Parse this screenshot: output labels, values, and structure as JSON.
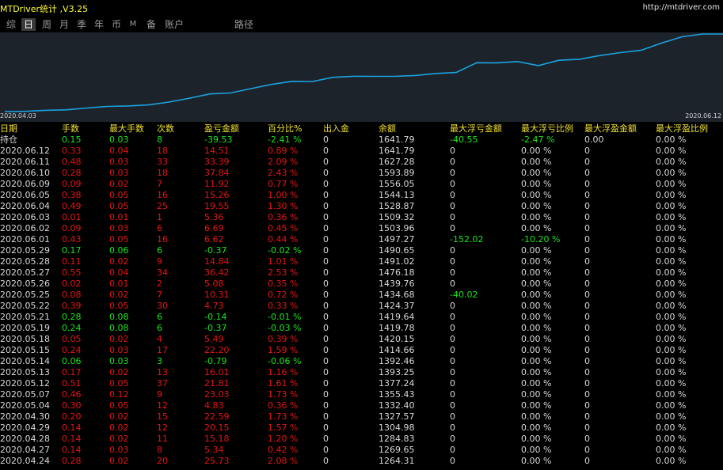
{
  "window": {
    "title": "MTDriver统计 ,V3.25",
    "url": "http://mtdriver.com"
  },
  "tabs": [
    {
      "label": "综",
      "active": false
    },
    {
      "label": "日",
      "active": true
    },
    {
      "label": "周",
      "active": false
    },
    {
      "label": "月",
      "active": false
    },
    {
      "label": "季",
      "active": false
    },
    {
      "label": "年",
      "active": false
    },
    {
      "label": "币",
      "active": false
    },
    {
      "label": "M",
      "active": false
    },
    {
      "label": "备",
      "active": false
    },
    {
      "label": "账户",
      "active": false
    },
    {
      "label": "路径",
      "active": false
    }
  ],
  "equity_chart": {
    "start_label": "2020.04.03",
    "end_label": "2020.06.12",
    "line_color": "#1aa3e0",
    "values": [
      1234.8,
      1236.2,
      1241.5,
      1244.1,
      1253.3,
      1261.8,
      1264.31,
      1269.65,
      1284.83,
      1304.98,
      1327.57,
      1332.4,
      1355.43,
      1377.24,
      1393.25,
      1392.46,
      1414.66,
      1420.15,
      1419.78,
      1419.64,
      1424.37,
      1434.68,
      1439.76,
      1491.02,
      1490.65,
      1497.27,
      1476.18,
      1503.96,
      1509.32,
      1528.87,
      1544.13,
      1556.05,
      1593.89,
      1627.28,
      1641.79,
      1641.79
    ]
  },
  "table": {
    "headers": [
      "日期",
      "手数",
      "最大手数",
      "次数",
      "盈亏金额",
      "百分比%",
      "出入金",
      "余额",
      "最大浮亏金额",
      "最大浮亏比例",
      "最大浮盈金额",
      "最大浮盈比例"
    ],
    "rows": [
      [
        "持仓",
        "0.15",
        "0.03",
        "8",
        "-39.53",
        "-2.41 %",
        "0",
        "1641.79",
        "-40.55",
        "-2.47 %",
        "0.00",
        "0.00 %"
      ],
      [
        "2020.06.12",
        "0.33",
        "0.04",
        "18",
        "14.51",
        "0.89 %",
        "0",
        "1641.79",
        "0",
        "0.00 %",
        "0",
        "0.00 %"
      ],
      [
        "2020.06.11",
        "0.48",
        "0.03",
        "33",
        "33.39",
        "2.09 %",
        "0",
        "1627.28",
        "0",
        "0.00 %",
        "0",
        "0.00 %"
      ],
      [
        "2020.06.10",
        "0.28",
        "0.03",
        "18",
        "37.84",
        "2.43 %",
        "0",
        "1593.89",
        "0",
        "0.00 %",
        "0",
        "0.00 %"
      ],
      [
        "2020.06.09",
        "0.09",
        "0.02",
        "7",
        "11.92",
        "0.77 %",
        "0",
        "1556.05",
        "0",
        "0.00 %",
        "0",
        "0.00 %"
      ],
      [
        "2020.06.05",
        "0.38",
        "0.05",
        "16",
        "15.26",
        "1.00 %",
        "0",
        "1544.13",
        "0",
        "0.00 %",
        "0",
        "0.00 %"
      ],
      [
        "2020.06.04",
        "0.49",
        "0.05",
        "25",
        "19.55",
        "1.30 %",
        "0",
        "1528.87",
        "0",
        "0.00 %",
        "0",
        "0.00 %"
      ],
      [
        "2020.06.03",
        "0.01",
        "0.01",
        "1",
        "5.36",
        "0.36 %",
        "0",
        "1509.32",
        "0",
        "0.00 %",
        "0",
        "0.00 %"
      ],
      [
        "2020.06.02",
        "0.09",
        "0.03",
        "6",
        "6.69",
        "0.45 %",
        "0",
        "1503.96",
        "0",
        "0.00 %",
        "0",
        "0.00 %"
      ],
      [
        "2020.06.01",
        "0.43",
        "0.05",
        "16",
        "6.62",
        "0.44 %",
        "0",
        "1497.27",
        "-152.02",
        "-10.20 %",
        "0",
        "0.00 %"
      ],
      [
        "2020.05.29",
        "0.17",
        "0.06",
        "6",
        "-0.37",
        "-0.02 %",
        "0",
        "1490.65",
        "0",
        "0.00 %",
        "0",
        "0.00 %"
      ],
      [
        "2020.05.28",
        "0.11",
        "0.02",
        "9",
        "14.84",
        "1.01 %",
        "0",
        "1491.02",
        "0",
        "0.00 %",
        "0",
        "0.00 %"
      ],
      [
        "2020.05.27",
        "0.55",
        "0.04",
        "34",
        "36.42",
        "2.53 %",
        "0",
        "1476.18",
        "0",
        "0.00 %",
        "0",
        "0.00 %"
      ],
      [
        "2020.05.26",
        "0.02",
        "0.01",
        "2",
        "5.08",
        "0.35 %",
        "0",
        "1439.76",
        "0",
        "0.00 %",
        "0",
        "0.00 %"
      ],
      [
        "2020.05.25",
        "0.08",
        "0.02",
        "7",
        "10.31",
        "0.72 %",
        "0",
        "1434.68",
        "-40.02",
        "0.00 %",
        "0",
        "0.00 %"
      ],
      [
        "2020.05.22",
        "0.39",
        "0.05",
        "30",
        "4.73",
        "0.33 %",
        "0",
        "1424.37",
        "0",
        "0.00 %",
        "0",
        "0.00 %"
      ],
      [
        "2020.05.21",
        "0.28",
        "0.08",
        "6",
        "-0.14",
        "-0.01 %",
        "0",
        "1419.64",
        "0",
        "0.00 %",
        "0",
        "0.00 %"
      ],
      [
        "2020.05.19",
        "0.24",
        "0.08",
        "6",
        "-0.37",
        "-0.03 %",
        "0",
        "1419.78",
        "0",
        "0.00 %",
        "0",
        "0.00 %"
      ],
      [
        "2020.05.18",
        "0.05",
        "0.02",
        "4",
        "5.49",
        "0.39 %",
        "0",
        "1420.15",
        "0",
        "0.00 %",
        "0",
        "0.00 %"
      ],
      [
        "2020.05.15",
        "0.24",
        "0.03",
        "17",
        "22.20",
        "1.59 %",
        "0",
        "1414.66",
        "0",
        "0.00 %",
        "0",
        "0.00 %"
      ],
      [
        "2020.05.14",
        "0.06",
        "0.03",
        "3",
        "-0.79",
        "-0.06 %",
        "0",
        "1392.46",
        "0",
        "0.00 %",
        "0",
        "0.00 %"
      ],
      [
        "2020.05.13",
        "0.17",
        "0.02",
        "13",
        "16.01",
        "1.16 %",
        "0",
        "1393.25",
        "0",
        "0.00 %",
        "0",
        "0.00 %"
      ],
      [
        "2020.05.12",
        "0.51",
        "0.05",
        "37",
        "21.81",
        "1.61 %",
        "0",
        "1377.24",
        "0",
        "0.00 %",
        "0",
        "0.00 %"
      ],
      [
        "2020.05.07",
        "0.46",
        "0.12",
        "9",
        "23.03",
        "1.73 %",
        "0",
        "1355.43",
        "0",
        "0.00 %",
        "0",
        "0.00 %"
      ],
      [
        "2020.05.04",
        "0.30",
        "0.05",
        "12",
        "4.83",
        "0.36 %",
        "0",
        "1332.40",
        "0",
        "0.00 %",
        "0",
        "0.00 %"
      ],
      [
        "2020.04.30",
        "0.20",
        "0.02",
        "15",
        "22.59",
        "1.73 %",
        "0",
        "1327.57",
        "0",
        "0.00 %",
        "0",
        "0.00 %"
      ],
      [
        "2020.04.29",
        "0.14",
        "0.02",
        "12",
        "20.15",
        "1.57 %",
        "0",
        "1304.98",
        "0",
        "0.00 %",
        "0",
        "0.00 %"
      ],
      [
        "2020.04.28",
        "0.14",
        "0.02",
        "11",
        "15.18",
        "1.20 %",
        "0",
        "1284.83",
        "0",
        "0.00 %",
        "0",
        "0.00 %"
      ],
      [
        "2020.04.27",
        "0.14",
        "0.03",
        "8",
        "5.34",
        "0.42 %",
        "0",
        "1269.65",
        "0",
        "0.00 %",
        "0",
        "0.00 %"
      ],
      [
        "2020.04.24",
        "0.28",
        "0.02",
        "20",
        "25.73",
        "2.08 %",
        "0",
        "1264.31",
        "0",
        "0.00 %",
        "0",
        "0.00 %"
      ]
    ]
  },
  "colors": {
    "profit_row": "#e81414",
    "loss_row": "#19e619",
    "header": "#f0e030",
    "chart_bg": "#1d232b"
  }
}
